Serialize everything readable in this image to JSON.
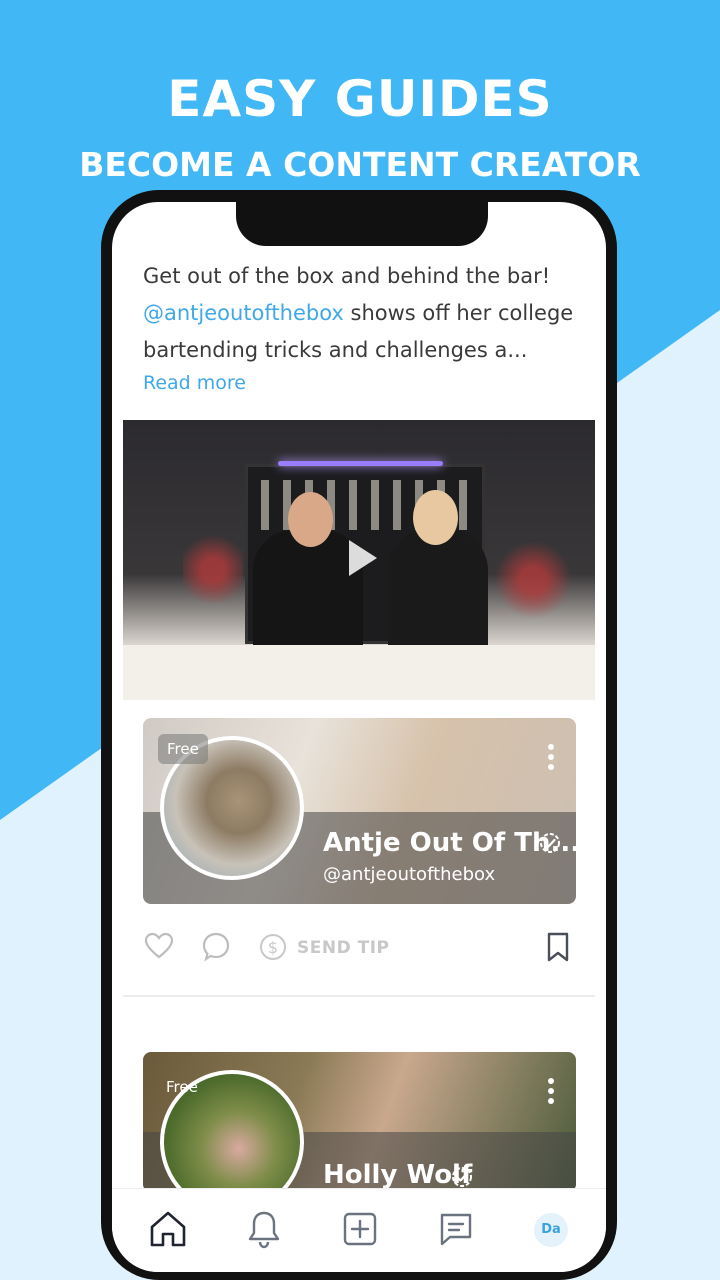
{
  "promo": {
    "headline": "EASY GUIDES",
    "subline": "BECOME A CONTENT CREATOR"
  },
  "post": {
    "text_line1": "Get out of the box and behind the bar!",
    "mention": "@antjeoutofthebox",
    "text_line2_rest": " shows off her college",
    "text_line3": "bartending tricks and challenges a...",
    "read_more": "Read more"
  },
  "cards": [
    {
      "badge": "Free",
      "name": "Antje Out Of Th...",
      "handle": "@antjeoutofthebox"
    },
    {
      "badge": "Free",
      "name": "Holly Wolf"
    }
  ],
  "actions": {
    "send_tip": "SEND TIP"
  },
  "tabbar": {
    "profile_initials": "Da"
  },
  "colors": {
    "accent": "#3fa9e8",
    "background_blue": "#41b8f5",
    "background_light": "#dff2fd"
  },
  "icons": [
    "home-icon",
    "bell-icon",
    "plus-square-icon",
    "message-icon",
    "heart-icon",
    "comment-icon",
    "dollar-icon",
    "bookmark-icon",
    "verified-icon",
    "more-icon",
    "play-icon"
  ]
}
